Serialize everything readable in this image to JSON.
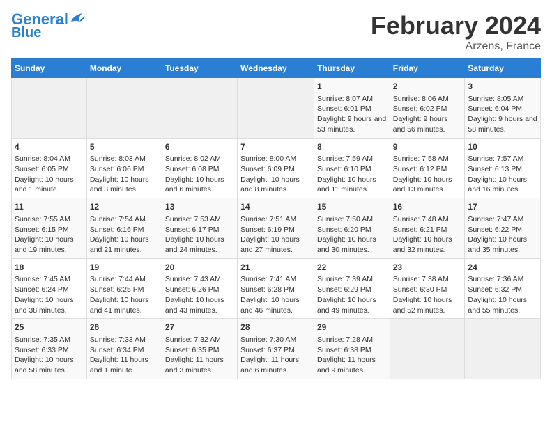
{
  "header": {
    "logo_line1": "General",
    "logo_line2": "Blue",
    "month": "February 2024",
    "location": "Arzens, France"
  },
  "days_of_week": [
    "Sunday",
    "Monday",
    "Tuesday",
    "Wednesday",
    "Thursday",
    "Friday",
    "Saturday"
  ],
  "weeks": [
    {
      "cells": [
        {
          "day": null,
          "content": null
        },
        {
          "day": null,
          "content": null
        },
        {
          "day": null,
          "content": null
        },
        {
          "day": null,
          "content": null
        },
        {
          "day": "1",
          "content": "Sunrise: 8:07 AM\nSunset: 6:01 PM\nDaylight: 9 hours and 53 minutes."
        },
        {
          "day": "2",
          "content": "Sunrise: 8:06 AM\nSunset: 6:02 PM\nDaylight: 9 hours and 56 minutes."
        },
        {
          "day": "3",
          "content": "Sunrise: 8:05 AM\nSunset: 6:04 PM\nDaylight: 9 hours and 58 minutes."
        }
      ]
    },
    {
      "cells": [
        {
          "day": "4",
          "content": "Sunrise: 8:04 AM\nSunset: 6:05 PM\nDaylight: 10 hours and 1 minute."
        },
        {
          "day": "5",
          "content": "Sunrise: 8:03 AM\nSunset: 6:06 PM\nDaylight: 10 hours and 3 minutes."
        },
        {
          "day": "6",
          "content": "Sunrise: 8:02 AM\nSunset: 6:08 PM\nDaylight: 10 hours and 6 minutes."
        },
        {
          "day": "7",
          "content": "Sunrise: 8:00 AM\nSunset: 6:09 PM\nDaylight: 10 hours and 8 minutes."
        },
        {
          "day": "8",
          "content": "Sunrise: 7:59 AM\nSunset: 6:10 PM\nDaylight: 10 hours and 11 minutes."
        },
        {
          "day": "9",
          "content": "Sunrise: 7:58 AM\nSunset: 6:12 PM\nDaylight: 10 hours and 13 minutes."
        },
        {
          "day": "10",
          "content": "Sunrise: 7:57 AM\nSunset: 6:13 PM\nDaylight: 10 hours and 16 minutes."
        }
      ]
    },
    {
      "cells": [
        {
          "day": "11",
          "content": "Sunrise: 7:55 AM\nSunset: 6:15 PM\nDaylight: 10 hours and 19 minutes."
        },
        {
          "day": "12",
          "content": "Sunrise: 7:54 AM\nSunset: 6:16 PM\nDaylight: 10 hours and 21 minutes."
        },
        {
          "day": "13",
          "content": "Sunrise: 7:53 AM\nSunset: 6:17 PM\nDaylight: 10 hours and 24 minutes."
        },
        {
          "day": "14",
          "content": "Sunrise: 7:51 AM\nSunset: 6:19 PM\nDaylight: 10 hours and 27 minutes."
        },
        {
          "day": "15",
          "content": "Sunrise: 7:50 AM\nSunset: 6:20 PM\nDaylight: 10 hours and 30 minutes."
        },
        {
          "day": "16",
          "content": "Sunrise: 7:48 AM\nSunset: 6:21 PM\nDaylight: 10 hours and 32 minutes."
        },
        {
          "day": "17",
          "content": "Sunrise: 7:47 AM\nSunset: 6:22 PM\nDaylight: 10 hours and 35 minutes."
        }
      ]
    },
    {
      "cells": [
        {
          "day": "18",
          "content": "Sunrise: 7:45 AM\nSunset: 6:24 PM\nDaylight: 10 hours and 38 minutes."
        },
        {
          "day": "19",
          "content": "Sunrise: 7:44 AM\nSunset: 6:25 PM\nDaylight: 10 hours and 41 minutes."
        },
        {
          "day": "20",
          "content": "Sunrise: 7:43 AM\nSunset: 6:26 PM\nDaylight: 10 hours and 43 minutes."
        },
        {
          "day": "21",
          "content": "Sunrise: 7:41 AM\nSunset: 6:28 PM\nDaylight: 10 hours and 46 minutes."
        },
        {
          "day": "22",
          "content": "Sunrise: 7:39 AM\nSunset: 6:29 PM\nDaylight: 10 hours and 49 minutes."
        },
        {
          "day": "23",
          "content": "Sunrise: 7:38 AM\nSunset: 6:30 PM\nDaylight: 10 hours and 52 minutes."
        },
        {
          "day": "24",
          "content": "Sunrise: 7:36 AM\nSunset: 6:32 PM\nDaylight: 10 hours and 55 minutes."
        }
      ]
    },
    {
      "cells": [
        {
          "day": "25",
          "content": "Sunrise: 7:35 AM\nSunset: 6:33 PM\nDaylight: 10 hours and 58 minutes."
        },
        {
          "day": "26",
          "content": "Sunrise: 7:33 AM\nSunset: 6:34 PM\nDaylight: 11 hours and 1 minute."
        },
        {
          "day": "27",
          "content": "Sunrise: 7:32 AM\nSunset: 6:35 PM\nDaylight: 11 hours and 3 minutes."
        },
        {
          "day": "28",
          "content": "Sunrise: 7:30 AM\nSunset: 6:37 PM\nDaylight: 11 hours and 6 minutes."
        },
        {
          "day": "29",
          "content": "Sunrise: 7:28 AM\nSunset: 6:38 PM\nDaylight: 11 hours and 9 minutes."
        },
        {
          "day": null,
          "content": null
        },
        {
          "day": null,
          "content": null
        }
      ]
    }
  ]
}
